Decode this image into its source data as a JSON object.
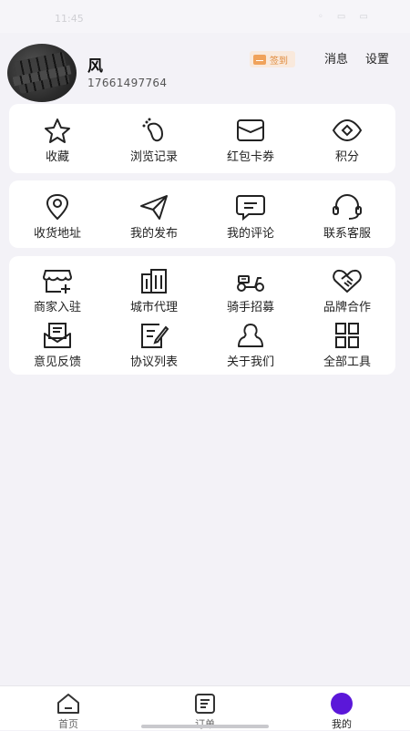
{
  "status_bar": {
    "time": "11:45",
    "icons_text": "◦ ▭ ▭"
  },
  "user": {
    "name": "风",
    "phone": "17661497764"
  },
  "header_actions": {
    "signin_label": "签到",
    "messages_label": "消息",
    "settings_label": "设置"
  },
  "accent_colors": {
    "signin_bg": "#f9e9dc",
    "signin_text": "#e08a3c",
    "profile_nav_dot": "#5b17d9"
  },
  "section1": [
    {
      "label": "收藏",
      "icon": "star-icon"
    },
    {
      "label": "浏览记录",
      "icon": "footprint-icon"
    },
    {
      "label": "红包卡券",
      "icon": "coupon-icon"
    },
    {
      "label": "积分",
      "icon": "points-eye-icon"
    }
  ],
  "section2": [
    {
      "label": "收货地址",
      "icon": "location-pin-icon"
    },
    {
      "label": "我的发布",
      "icon": "paper-plane-icon"
    },
    {
      "label": "我的评论",
      "icon": "comment-icon"
    },
    {
      "label": "联系客服",
      "icon": "headset-icon"
    }
  ],
  "section3": [
    {
      "label": "商家入驻",
      "icon": "shop-add-icon"
    },
    {
      "label": "城市代理",
      "icon": "building-icon"
    },
    {
      "label": "骑手招募",
      "icon": "scooter-icon"
    },
    {
      "label": "品牌合作",
      "icon": "handshake-icon"
    },
    {
      "label": "意见反馈",
      "icon": "feedback-mail-icon"
    },
    {
      "label": "协议列表",
      "icon": "agreement-edit-icon"
    },
    {
      "label": "关于我们",
      "icon": "about-person-icon"
    },
    {
      "label": "全部工具",
      "icon": "all-tools-grid-icon"
    }
  ],
  "bottom_nav": [
    {
      "label": "首页",
      "icon": "home-icon"
    },
    {
      "label": "订单",
      "icon": "order-list-icon"
    },
    {
      "label": "我的",
      "icon": "profile-dot-icon",
      "active": true
    }
  ]
}
